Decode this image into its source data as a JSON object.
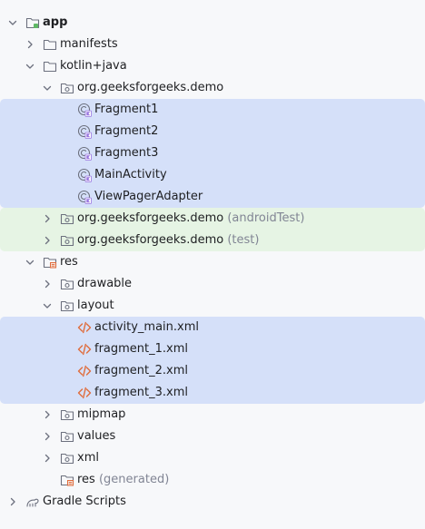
{
  "tree": [
    {
      "label": "app",
      "icon": "module-folder-icon",
      "chevron": "down",
      "level": 0,
      "bold": true
    },
    {
      "label": "manifests",
      "icon": "folder-icon",
      "chevron": "right",
      "level": 1
    },
    {
      "label": "kotlin+java",
      "icon": "folder-icon",
      "chevron": "down",
      "level": 1
    },
    {
      "label": "org.geeksforgeeks.demo",
      "icon": "package-icon",
      "chevron": "down",
      "level": 2
    },
    {
      "label": "Fragment1",
      "icon": "kotlin-class-icon",
      "level": 3,
      "bg": "blue"
    },
    {
      "label": "Fragment2",
      "icon": "kotlin-class-icon",
      "level": 3,
      "bg": "blue"
    },
    {
      "label": "Fragment3",
      "icon": "kotlin-class-icon",
      "level": 3,
      "bg": "blue"
    },
    {
      "label": "MainActivity",
      "icon": "kotlin-class-icon",
      "level": 3,
      "bg": "blue"
    },
    {
      "label": "ViewPagerAdapter",
      "icon": "kotlin-class-icon",
      "level": 3,
      "bg": "blue"
    },
    {
      "label": "org.geeksforgeeks.demo",
      "suffix": "(androidTest)",
      "icon": "package-icon",
      "chevron": "right",
      "level": 2,
      "bg": "green"
    },
    {
      "label": "org.geeksforgeeks.demo",
      "suffix": "(test)",
      "icon": "package-icon",
      "chevron": "right",
      "level": 2,
      "bg": "green"
    },
    {
      "label": "res",
      "icon": "resource-folder-icon",
      "chevron": "down",
      "level": 1
    },
    {
      "label": "drawable",
      "icon": "package-icon",
      "chevron": "right",
      "level": 2
    },
    {
      "label": "layout",
      "icon": "package-icon",
      "chevron": "down",
      "level": 2
    },
    {
      "label": "activity_main.xml",
      "icon": "xml-file-icon",
      "level": 3,
      "bg": "blue"
    },
    {
      "label": "fragment_1.xml",
      "icon": "xml-file-icon",
      "level": 3,
      "bg": "blue"
    },
    {
      "label": "fragment_2.xml",
      "icon": "xml-file-icon",
      "level": 3,
      "bg": "blue"
    },
    {
      "label": "fragment_3.xml",
      "icon": "xml-file-icon",
      "level": 3,
      "bg": "blue"
    },
    {
      "label": "mipmap",
      "icon": "package-icon",
      "chevron": "right",
      "level": 2
    },
    {
      "label": "values",
      "icon": "package-icon",
      "chevron": "right",
      "level": 2
    },
    {
      "label": "xml",
      "icon": "package-icon",
      "chevron": "right",
      "level": 2
    },
    {
      "label": "res",
      "suffix": "(generated)",
      "icon": "resource-folder-icon",
      "level": 2
    },
    {
      "label": "Gradle Scripts",
      "icon": "gradle-icon",
      "chevron": "right",
      "level": 0
    }
  ],
  "colors": {
    "background": "#f7f8fa",
    "selection_blue": "#d5e0f9",
    "test_green": "#e6f4e4",
    "text": "#1e1f22",
    "secondary_text": "#818594",
    "icon_gray": "#6c707e",
    "kotlin_accent": "#9975e0",
    "xml_orange": "#e06c3c"
  }
}
